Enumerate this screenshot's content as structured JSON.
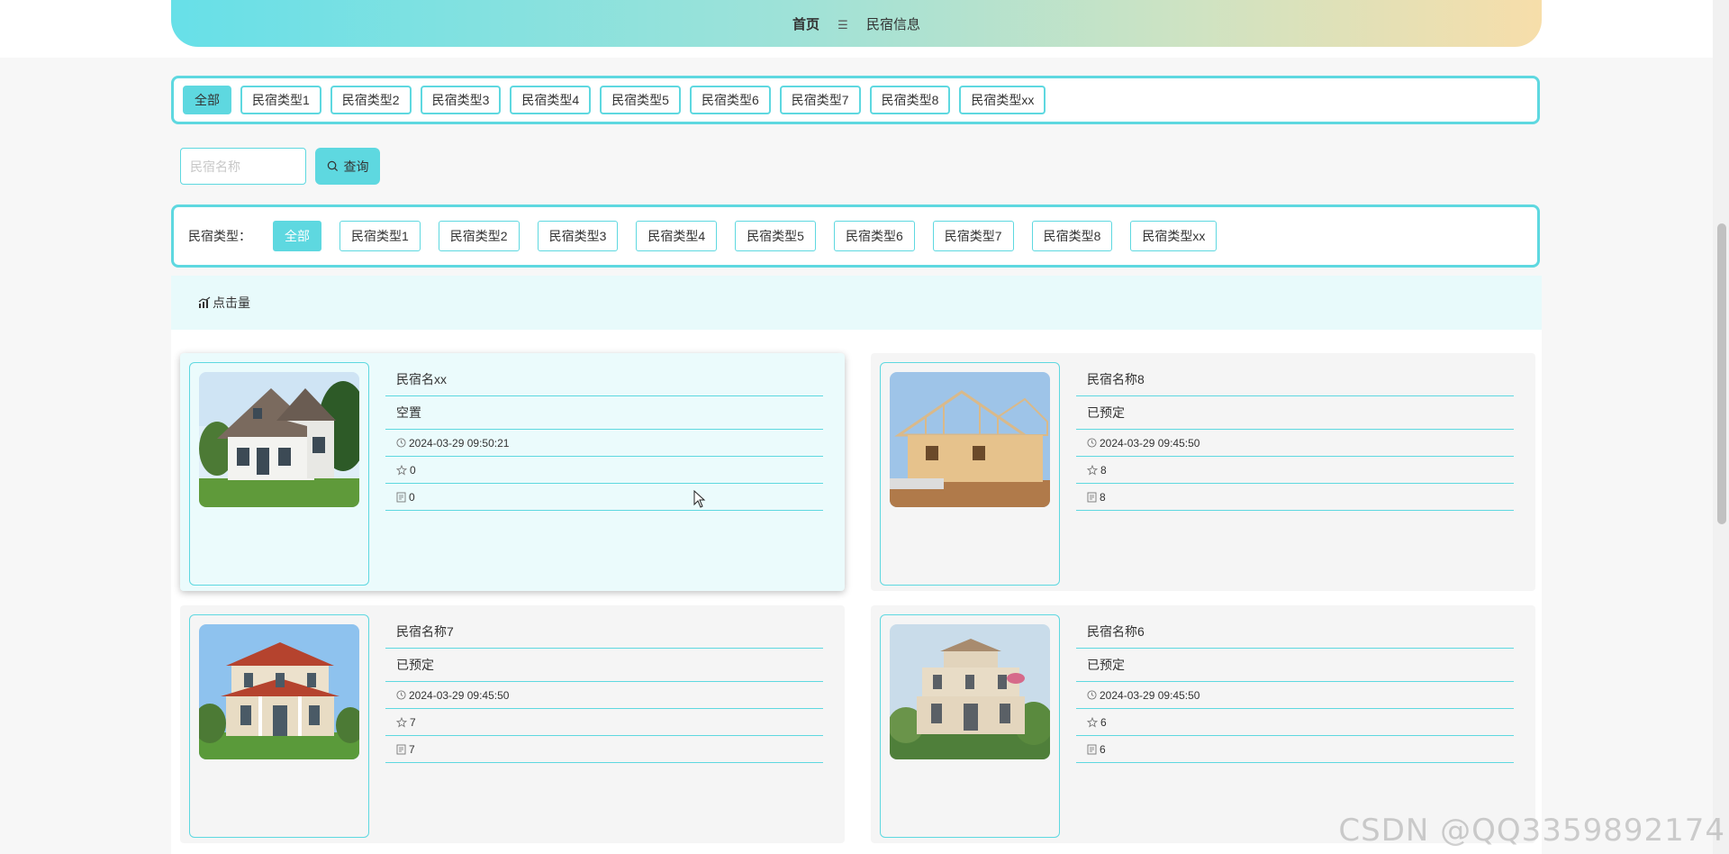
{
  "breadcrumb": {
    "home": "首页",
    "separator": "☰",
    "current": "民宿信息"
  },
  "category_tabs": [
    "全部",
    "民宿类型1",
    "民宿类型2",
    "民宿类型3",
    "民宿类型4",
    "民宿类型5",
    "民宿类型6",
    "民宿类型7",
    "民宿类型8",
    "民宿类型xx"
  ],
  "category_tabs_active": 0,
  "search": {
    "placeholder": "民宿名称",
    "value": "",
    "button_label": "查询",
    "button_icon": "search-icon"
  },
  "filter": {
    "label": "民宿类型：",
    "options": [
      "全部",
      "民宿类型1",
      "民宿类型2",
      "民宿类型3",
      "民宿类型4",
      "民宿类型5",
      "民宿类型6",
      "民宿类型7",
      "民宿类型8",
      "民宿类型xx"
    ],
    "active": 0
  },
  "sort": {
    "label": "点击量",
    "icon": "chart-icon"
  },
  "cards": [
    {
      "name": "民宿名xx",
      "status": "空置",
      "time": "2024-03-29 09:50:21",
      "favorites": "0",
      "views": "0",
      "image": "white-gable-house"
    },
    {
      "name": "民宿名称8",
      "status": "已预定",
      "time": "2024-03-29 09:45:50",
      "favorites": "8",
      "views": "8",
      "image": "timber-frame-construction"
    },
    {
      "name": "民宿名称7",
      "status": "已预定",
      "time": "2024-03-29 09:45:50",
      "favorites": "7",
      "views": "7",
      "image": "villa-red-roof"
    },
    {
      "name": "民宿名称6",
      "status": "已预定",
      "time": "2024-03-29 09:45:50",
      "favorites": "6",
      "views": "6",
      "image": "villa-beige"
    }
  ],
  "watermark": "CSDN @QQ3359892174",
  "colors": {
    "accent": "#5ed8e0",
    "header_start": "#67e0e8",
    "header_end": "#f7deaa"
  }
}
